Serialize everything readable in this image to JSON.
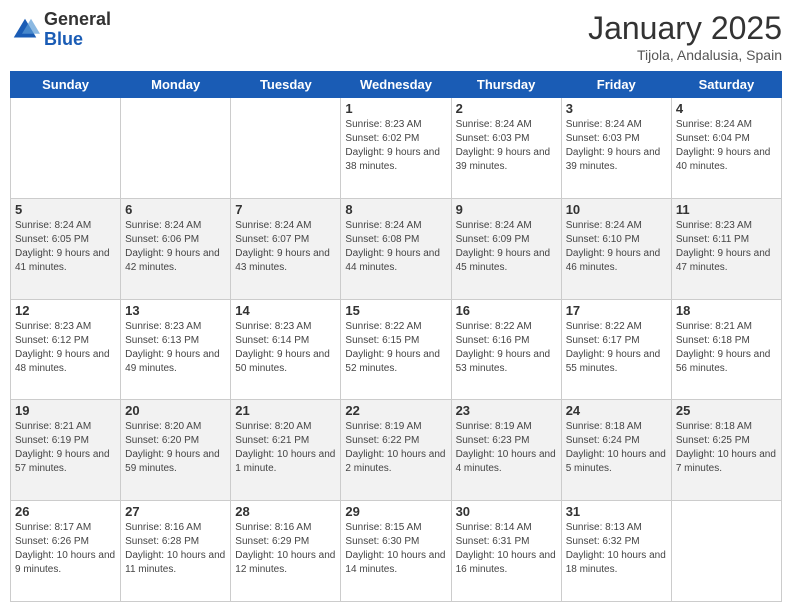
{
  "header": {
    "logo_general": "General",
    "logo_blue": "Blue",
    "month_title": "January 2025",
    "location": "Tijola, Andalusia, Spain"
  },
  "days_of_week": [
    "Sunday",
    "Monday",
    "Tuesday",
    "Wednesday",
    "Thursday",
    "Friday",
    "Saturday"
  ],
  "weeks": [
    [
      {
        "day": "",
        "info": ""
      },
      {
        "day": "",
        "info": ""
      },
      {
        "day": "",
        "info": ""
      },
      {
        "day": "1",
        "info": "Sunrise: 8:23 AM\nSunset: 6:02 PM\nDaylight: 9 hours and 38 minutes."
      },
      {
        "day": "2",
        "info": "Sunrise: 8:24 AM\nSunset: 6:03 PM\nDaylight: 9 hours and 39 minutes."
      },
      {
        "day": "3",
        "info": "Sunrise: 8:24 AM\nSunset: 6:03 PM\nDaylight: 9 hours and 39 minutes."
      },
      {
        "day": "4",
        "info": "Sunrise: 8:24 AM\nSunset: 6:04 PM\nDaylight: 9 hours and 40 minutes."
      }
    ],
    [
      {
        "day": "5",
        "info": "Sunrise: 8:24 AM\nSunset: 6:05 PM\nDaylight: 9 hours and 41 minutes."
      },
      {
        "day": "6",
        "info": "Sunrise: 8:24 AM\nSunset: 6:06 PM\nDaylight: 9 hours and 42 minutes."
      },
      {
        "day": "7",
        "info": "Sunrise: 8:24 AM\nSunset: 6:07 PM\nDaylight: 9 hours and 43 minutes."
      },
      {
        "day": "8",
        "info": "Sunrise: 8:24 AM\nSunset: 6:08 PM\nDaylight: 9 hours and 44 minutes."
      },
      {
        "day": "9",
        "info": "Sunrise: 8:24 AM\nSunset: 6:09 PM\nDaylight: 9 hours and 45 minutes."
      },
      {
        "day": "10",
        "info": "Sunrise: 8:24 AM\nSunset: 6:10 PM\nDaylight: 9 hours and 46 minutes."
      },
      {
        "day": "11",
        "info": "Sunrise: 8:23 AM\nSunset: 6:11 PM\nDaylight: 9 hours and 47 minutes."
      }
    ],
    [
      {
        "day": "12",
        "info": "Sunrise: 8:23 AM\nSunset: 6:12 PM\nDaylight: 9 hours and 48 minutes."
      },
      {
        "day": "13",
        "info": "Sunrise: 8:23 AM\nSunset: 6:13 PM\nDaylight: 9 hours and 49 minutes."
      },
      {
        "day": "14",
        "info": "Sunrise: 8:23 AM\nSunset: 6:14 PM\nDaylight: 9 hours and 50 minutes."
      },
      {
        "day": "15",
        "info": "Sunrise: 8:22 AM\nSunset: 6:15 PM\nDaylight: 9 hours and 52 minutes."
      },
      {
        "day": "16",
        "info": "Sunrise: 8:22 AM\nSunset: 6:16 PM\nDaylight: 9 hours and 53 minutes."
      },
      {
        "day": "17",
        "info": "Sunrise: 8:22 AM\nSunset: 6:17 PM\nDaylight: 9 hours and 55 minutes."
      },
      {
        "day": "18",
        "info": "Sunrise: 8:21 AM\nSunset: 6:18 PM\nDaylight: 9 hours and 56 minutes."
      }
    ],
    [
      {
        "day": "19",
        "info": "Sunrise: 8:21 AM\nSunset: 6:19 PM\nDaylight: 9 hours and 57 minutes."
      },
      {
        "day": "20",
        "info": "Sunrise: 8:20 AM\nSunset: 6:20 PM\nDaylight: 9 hours and 59 minutes."
      },
      {
        "day": "21",
        "info": "Sunrise: 8:20 AM\nSunset: 6:21 PM\nDaylight: 10 hours and 1 minute."
      },
      {
        "day": "22",
        "info": "Sunrise: 8:19 AM\nSunset: 6:22 PM\nDaylight: 10 hours and 2 minutes."
      },
      {
        "day": "23",
        "info": "Sunrise: 8:19 AM\nSunset: 6:23 PM\nDaylight: 10 hours and 4 minutes."
      },
      {
        "day": "24",
        "info": "Sunrise: 8:18 AM\nSunset: 6:24 PM\nDaylight: 10 hours and 5 minutes."
      },
      {
        "day": "25",
        "info": "Sunrise: 8:18 AM\nSunset: 6:25 PM\nDaylight: 10 hours and 7 minutes."
      }
    ],
    [
      {
        "day": "26",
        "info": "Sunrise: 8:17 AM\nSunset: 6:26 PM\nDaylight: 10 hours and 9 minutes."
      },
      {
        "day": "27",
        "info": "Sunrise: 8:16 AM\nSunset: 6:28 PM\nDaylight: 10 hours and 11 minutes."
      },
      {
        "day": "28",
        "info": "Sunrise: 8:16 AM\nSunset: 6:29 PM\nDaylight: 10 hours and 12 minutes."
      },
      {
        "day": "29",
        "info": "Sunrise: 8:15 AM\nSunset: 6:30 PM\nDaylight: 10 hours and 14 minutes."
      },
      {
        "day": "30",
        "info": "Sunrise: 8:14 AM\nSunset: 6:31 PM\nDaylight: 10 hours and 16 minutes."
      },
      {
        "day": "31",
        "info": "Sunrise: 8:13 AM\nSunset: 6:32 PM\nDaylight: 10 hours and 18 minutes."
      },
      {
        "day": "",
        "info": ""
      }
    ]
  ]
}
